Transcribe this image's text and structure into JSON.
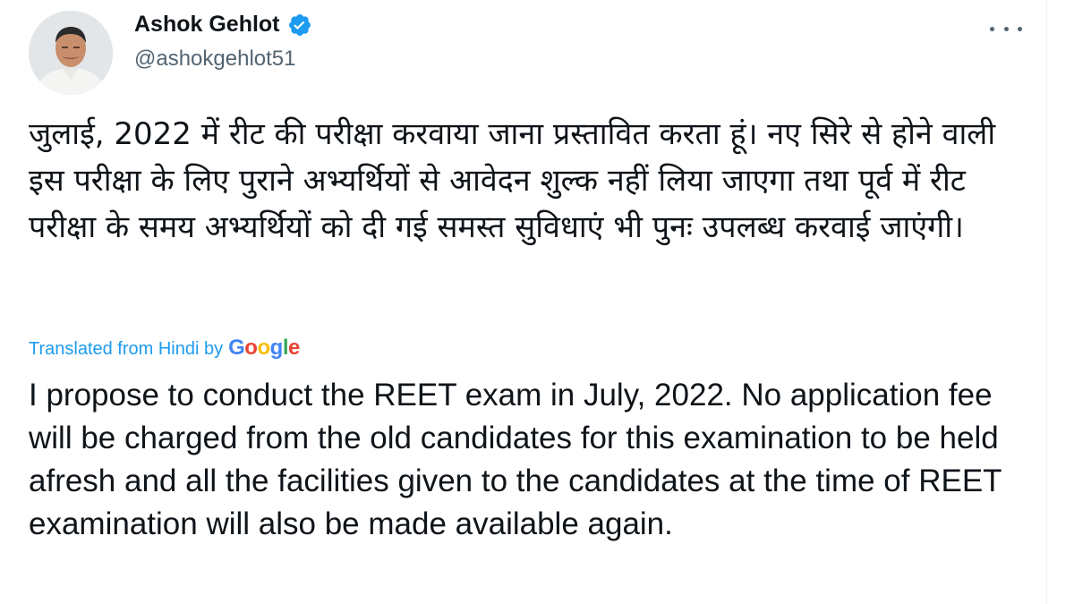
{
  "tweet": {
    "author": {
      "display_name": "Ashok Gehlot",
      "handle": "@ashokgehlot51",
      "verified": true
    },
    "more_menu_icon": "more-horizontal-icon",
    "original_text": "जुलाई, 2022 में रीट की परीक्षा करवाया जाना प्रस्तावित करता हूं। नए सिरे से होने वाली इस परीक्षा के लिए पुराने अभ्यर्थियों से आवेदन शुल्क नहीं लिया जाएगा तथा पूर्व में रीट परीक्षा के समय अभ्यर्थियों को दी गई समस्त सुविधाएं भी पुनः उपलब्ध करवाई जाएंगी।",
    "translation": {
      "label": "Translated from Hindi by",
      "provider": "Google",
      "text": "I propose to conduct the REET exam in July, 2022. No application fee will be charged from the old candidates for this examination to be held afresh and all the facilities given to the candidates at the time of REET examination will also be made available again."
    }
  },
  "colors": {
    "text_primary": "#0f1419",
    "text_secondary": "#536471",
    "accent": "#1d9bf0",
    "google_blue": "#4285f4",
    "google_red": "#ea4335",
    "google_yellow": "#fbbc05",
    "google_green": "#34a853"
  }
}
